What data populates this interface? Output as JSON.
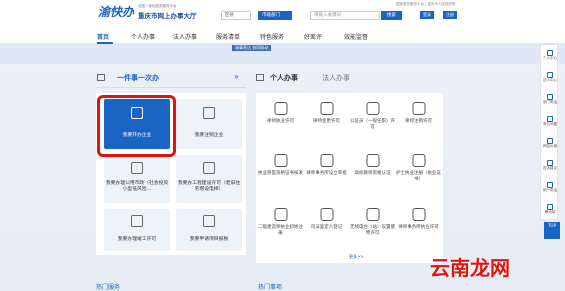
{
  "header": {
    "logo": "渝快办",
    "logo_subtitle": "全国一体化政务服务平台",
    "site_title": "重庆市网上办事大厅",
    "region_select": "区县",
    "dept_select": "市级部门",
    "search_placeholder": "请输入关键词",
    "search_button": "搜索",
    "top_links": "国家政务服务平台 | 重庆市人民政府网",
    "login_button": "登录",
    "register_button": "注册"
  },
  "nav": {
    "items": [
      {
        "label": "首页"
      },
      {
        "label": "个人办事"
      },
      {
        "label": "法人办事"
      },
      {
        "label": "服务清单"
      },
      {
        "label": "特色服务"
      },
      {
        "label": "好差评"
      },
      {
        "label": "效能监督"
      }
    ]
  },
  "banner": {
    "text": "渝事直达 协同联动"
  },
  "left_section": {
    "title": "一件事一次办",
    "chevron": "»",
    "tiles": [
      {
        "label": "我要开办企业"
      },
      {
        "label": "我要注销企业"
      },
      {
        "label": "我要办理公用市政（社会投资小型低风险…"
      },
      {
        "label": "我要办工程建设许可（老旧住宅增设电梯）"
      },
      {
        "label": "我要办理竣工许可"
      },
      {
        "label": "我要申请项目报税"
      }
    ]
  },
  "right_section": {
    "tab1": "个人办事",
    "tab2": "法人办事",
    "items": [
      {
        "label": "律师执业许可"
      },
      {
        "label": "律师变更许可"
      },
      {
        "label": "公证员（一般任职）许可"
      },
      {
        "label": "律师注销许可"
      },
      {
        "label": "执业兽医资格证书核发"
      },
      {
        "label": "律师事务所设立审批"
      },
      {
        "label": "高校教师资格认证"
      },
      {
        "label": "护士执业注册（执业证书）"
      },
      {
        "label": "二级建造师执业初始注册"
      },
      {
        "label": "司法鉴定人登记"
      },
      {
        "label": "无线电台（站）设置使用许可"
      },
      {
        "label": "律师事务所执业许可"
      }
    ],
    "more": "更多>>"
  },
  "bottom": {
    "left": "热门服务",
    "right": "热门事项"
  },
  "sidebar": {
    "items": [
      {
        "label": "个人中心"
      },
      {
        "label": "法人中心"
      },
      {
        "label": "部门电话"
      },
      {
        "label": "常见问题"
      },
      {
        "label": "网站纠错"
      },
      {
        "label": "投诉建议"
      },
      {
        "label": "统一电话"
      },
      {
        "label": "移动端"
      }
    ],
    "top": "TOP"
  },
  "watermark": "云南龙网",
  "colors": {
    "brand": "#1a64c4",
    "highlight": "#e3120b"
  }
}
